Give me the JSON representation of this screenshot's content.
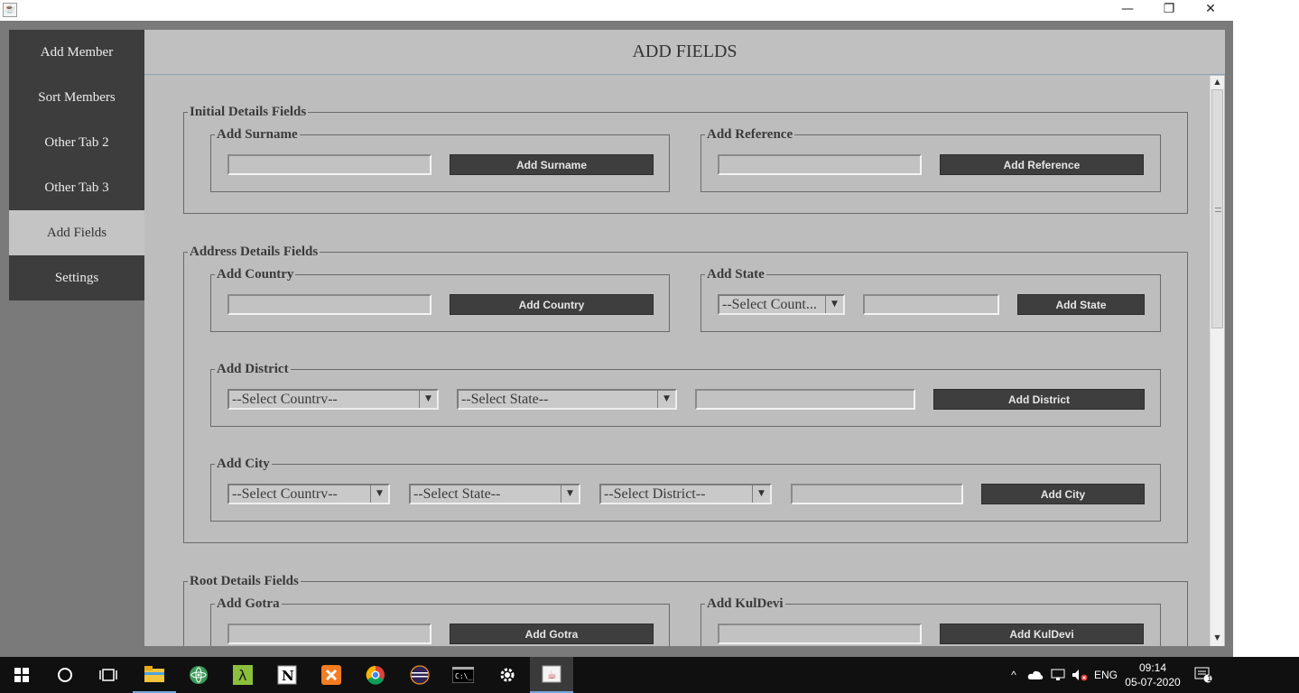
{
  "window": {
    "minimize": "—",
    "restore": "❐",
    "close": "✕"
  },
  "sidebar": {
    "items": [
      {
        "label": "Add Member"
      },
      {
        "label": "Sort Members"
      },
      {
        "label": "Other Tab 2"
      },
      {
        "label": "Other Tab 3"
      },
      {
        "label": "Add Fields",
        "active": true
      },
      {
        "label": "Settings"
      }
    ]
  },
  "header": {
    "title": "ADD FIELDS"
  },
  "sections": {
    "initial": {
      "legend": "Initial Details Fields",
      "surname": {
        "legend": "Add Surname",
        "value": "",
        "button": "Add Surname"
      },
      "reference": {
        "legend": "Add Reference",
        "value": "",
        "button": "Add Reference"
      }
    },
    "address": {
      "legend": "Address Details Fields",
      "country": {
        "legend": "Add Country",
        "value": "",
        "button": "Add Country"
      },
      "state": {
        "legend": "Add State",
        "country_select": "--Select Count...",
        "value": "",
        "button": "Add State"
      },
      "district": {
        "legend": "Add District",
        "country_select": "--Select Countrv--",
        "state_select": "--Select State--",
        "value": "",
        "button": "Add District"
      },
      "city": {
        "legend": "Add City",
        "country_select": "--Select Countrv--",
        "state_select": "--Select State--",
        "district_select": "--Select District--",
        "value": "",
        "button": "Add City"
      }
    },
    "root": {
      "legend": "Root Details Fields",
      "gotra": {
        "legend": "Add Gotra",
        "value": "",
        "button": "Add Gotra"
      },
      "kuldevi": {
        "legend": "Add KulDevi",
        "value": "",
        "button": "Add KulDevi"
      }
    }
  },
  "taskbar": {
    "lang": "ENG",
    "time": "09:14",
    "date": "05-07-2020",
    "notification_count": "1"
  }
}
